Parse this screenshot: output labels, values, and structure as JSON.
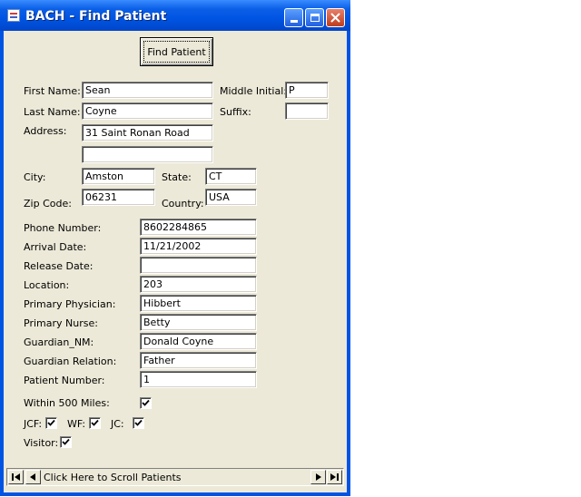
{
  "window": {
    "title": "BACH - Find Patient"
  },
  "find_button": {
    "label": "Find Patient"
  },
  "labels": {
    "first_name": "First Name:",
    "middle_initial": "Middle Initial:",
    "last_name": "Last Name:",
    "suffix": "Suffix:",
    "address": "Address:",
    "city": "City:",
    "state": "State:",
    "zip": "Zip Code:",
    "country": "Country:",
    "phone": "Phone Number:",
    "arrival": "Arrival Date:",
    "release": "Release Date:",
    "location": "Location:",
    "physician": "Primary Physician:",
    "nurse": "Primary Nurse:",
    "guardian_nm": "Guardian_NM:",
    "guardian_relation": "Guardian Relation:",
    "patient_number": "Patient Number:",
    "within_500": "Within 500 Miles:",
    "jcf": "JCF:",
    "wf": "WF:",
    "jc": "JC:",
    "visitor": "Visitor:"
  },
  "values": {
    "first_name": "Sean",
    "middle_initial": "P",
    "last_name": "Coyne",
    "suffix": "",
    "address1": "31 Saint Ronan Road",
    "address2": "",
    "city": "Amston",
    "state": "CT",
    "zip": "06231",
    "country": "USA",
    "phone": "8602284865",
    "arrival": "11/21/2002",
    "release": "",
    "location": "203",
    "physician": "Hibbert",
    "nurse": "Betty",
    "guardian_nm": "Donald Coyne",
    "guardian_relation": "Father",
    "patient_number": "1"
  },
  "checkboxes": {
    "within_500": true,
    "jcf": true,
    "wf": true,
    "jc": true,
    "visitor": true
  },
  "navigator": {
    "caption": "Click Here to Scroll Patients"
  },
  "icons": {
    "app": "app-window-icon",
    "minimize": "minimize-icon",
    "maximize": "maximize-icon",
    "close": "close-icon",
    "first": "first-record-icon",
    "prev": "previous-record-icon",
    "next": "next-record-icon",
    "last": "last-record-icon"
  },
  "colors": {
    "titlebar": "#0054e3",
    "client": "#ece9d8",
    "close_button": "#c03c1c"
  }
}
